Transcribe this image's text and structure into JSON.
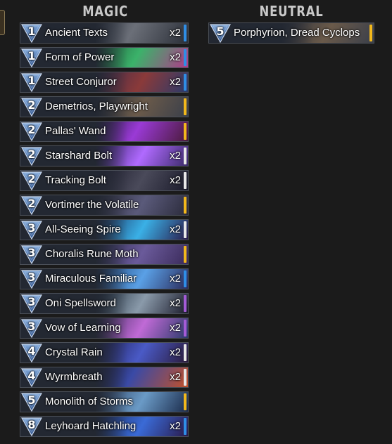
{
  "colors": {
    "common": "#e8e8e8",
    "rare": "#2f8ee6",
    "epic": "#a45bd6",
    "legendary": "#f2b81b",
    "gem_top": "#7fa7d9",
    "gem_bottom": "#2a4f8a"
  },
  "sections": {
    "magic": {
      "title": "MAGIC",
      "cards": [
        {
          "cost": "1",
          "name": "Ancient Texts",
          "count": "x2",
          "rarity": "rare"
        },
        {
          "cost": "1",
          "name": "Form of Power",
          "count": "x2",
          "rarity": "rare"
        },
        {
          "cost": "1",
          "name": "Street Conjuror",
          "count": "x2",
          "rarity": "rare"
        },
        {
          "cost": "2",
          "name": "Demetrios, Playwright",
          "count": "",
          "rarity": "legendary"
        },
        {
          "cost": "2",
          "name": "Pallas' Wand",
          "count": "",
          "rarity": "legendary"
        },
        {
          "cost": "2",
          "name": "Starshard Bolt",
          "count": "x2",
          "rarity": "common"
        },
        {
          "cost": "2",
          "name": "Tracking Bolt",
          "count": "x2",
          "rarity": "common"
        },
        {
          "cost": "2",
          "name": "Vortimer the Volatile",
          "count": "",
          "rarity": "legendary"
        },
        {
          "cost": "3",
          "name": "All-Seeing Spire",
          "count": "x2",
          "rarity": "common"
        },
        {
          "cost": "3",
          "name": "Choralis Rune Moth",
          "count": "",
          "rarity": "legendary"
        },
        {
          "cost": "3",
          "name": "Miraculous Familiar",
          "count": "x2",
          "rarity": "rare"
        },
        {
          "cost": "3",
          "name": "Oni Spellsword",
          "count": "x2",
          "rarity": "epic"
        },
        {
          "cost": "3",
          "name": "Vow of Learning",
          "count": "x2",
          "rarity": "epic"
        },
        {
          "cost": "4",
          "name": "Crystal Rain",
          "count": "x2",
          "rarity": "common"
        },
        {
          "cost": "4",
          "name": "Wyrmbreath",
          "count": "x2",
          "rarity": "common"
        },
        {
          "cost": "5",
          "name": "Monolith of Storms",
          "count": "",
          "rarity": "legendary"
        },
        {
          "cost": "8",
          "name": "Leyhoard Hatchling",
          "count": "x2",
          "rarity": "rare"
        }
      ]
    },
    "neutral": {
      "title": "NEUTRAL",
      "cards": [
        {
          "cost": "5",
          "name": "Porphyrion, Dread Cyclops",
          "count": "",
          "rarity": "legendary"
        }
      ]
    }
  }
}
